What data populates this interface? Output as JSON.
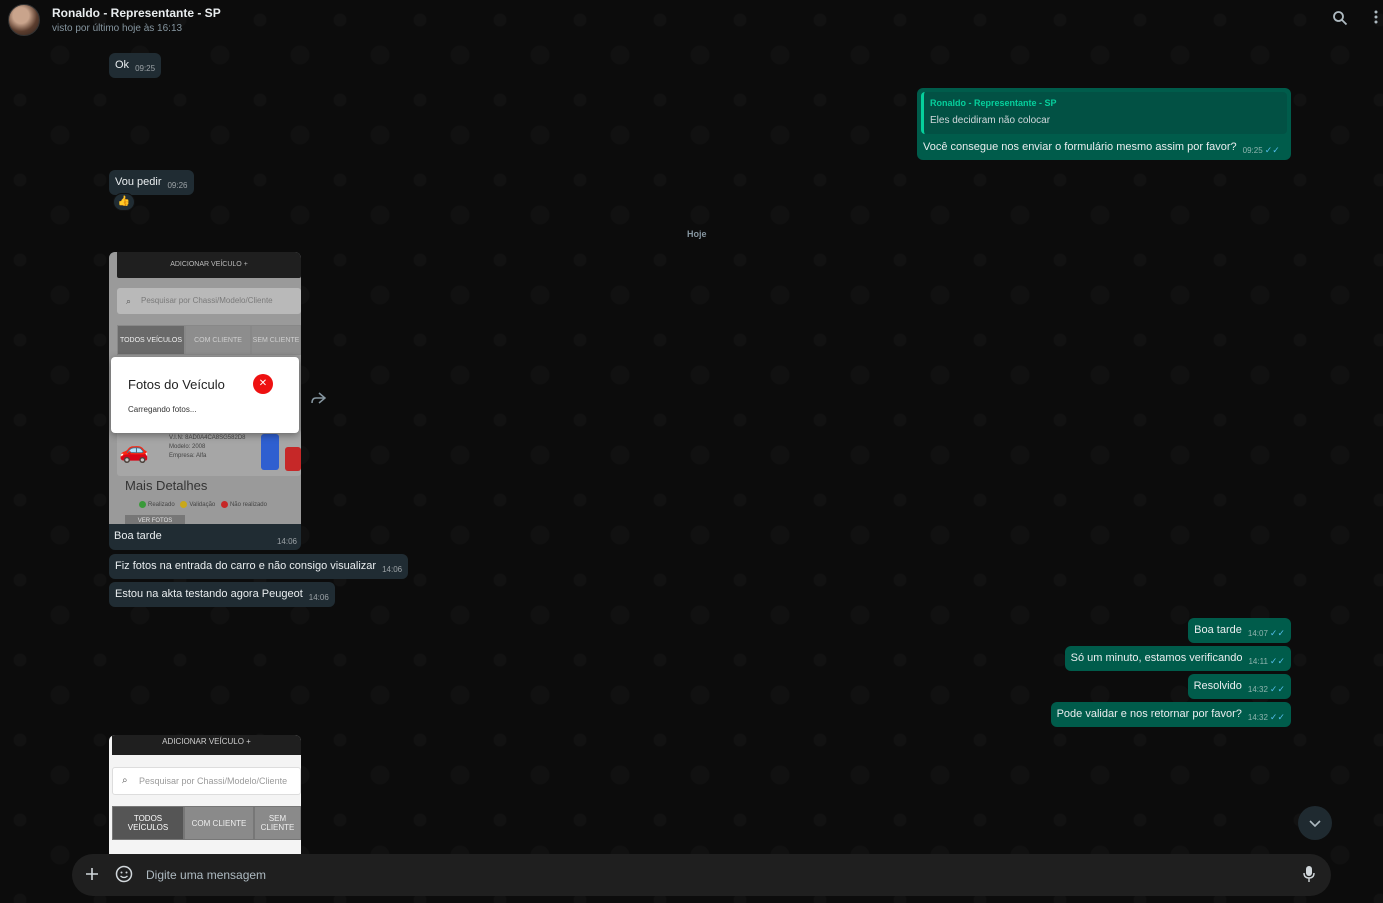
{
  "header": {
    "name": "Ronaldo - Representante - SP",
    "status": "visto por último hoje às 16:13"
  },
  "messages": {
    "m1": {
      "text": "Ok",
      "time": "09:25"
    },
    "m2": {
      "quote_author": "Ronaldo - Representante - SP",
      "quote_text": "Eles decidiram não colocar",
      "text": "Você consegue nos enviar o formulário mesmo assim por favor?",
      "time": "09:25"
    },
    "m3": {
      "text": "Vou pedir",
      "time": "09:26",
      "reaction": "👍"
    },
    "day": "Hoje",
    "image1": {
      "top_label": "ADICIONAR VEÍCULO   +",
      "search_placeholder": "Pesquisar por Chassi/Modelo/Cliente",
      "tabs": [
        "TODOS VEÍCULOS",
        "COM CLIENTE",
        "SEM CLIENTE"
      ],
      "modal_title": "Fotos do Veículo",
      "modal_sub": "Carregando fotos...",
      "card_line1": "V.I.N: 8AD0A4CA8SG582D8",
      "card_line2": "Modelo: 2008",
      "card_line3": "Empresa: Alfa",
      "more": "Mais Detalhes",
      "legend": [
        "Realizado",
        "Validação",
        "Não realizado"
      ],
      "button": "VER FOTOS",
      "caption": "Boa tarde",
      "time": "14:06"
    },
    "m4": {
      "text": "Fiz fotos na entrada do carro e não consigo visualizar",
      "time": "14:06"
    },
    "m5": {
      "text": "Estou na akta testando agora Peugeot",
      "time": "14:06"
    },
    "m6": {
      "text": "Boa tarde",
      "time": "14:07"
    },
    "m7": {
      "text": "Só um minuto, estamos verificando",
      "time": "14:11"
    },
    "m8": {
      "text": "Resolvido",
      "time": "14:32"
    },
    "m9": {
      "text": "Pode validar e nos retornar por favor?",
      "time": "14:32"
    },
    "image2": {
      "top_label": "ADICIONAR VEÍCULO   +",
      "search_placeholder": "Pesquisar por Chassi/Modelo/Cliente",
      "tabs": [
        "TODOS VEÍCULOS",
        "COM CLIENTE",
        "SEM CLIENTE"
      ]
    }
  },
  "composer": {
    "placeholder": "Digite uma mensagem"
  },
  "icons": {
    "search": "search-icon",
    "menu": "menu-icon",
    "plus": "plus-icon",
    "sticker": "sticker-icon",
    "mic": "mic-icon",
    "chevron": "chevron-down-icon",
    "forward": "forward-icon"
  },
  "colors": {
    "incoming": "#202c33",
    "outgoing": "#005c4b",
    "tick": "#53bdeb"
  }
}
